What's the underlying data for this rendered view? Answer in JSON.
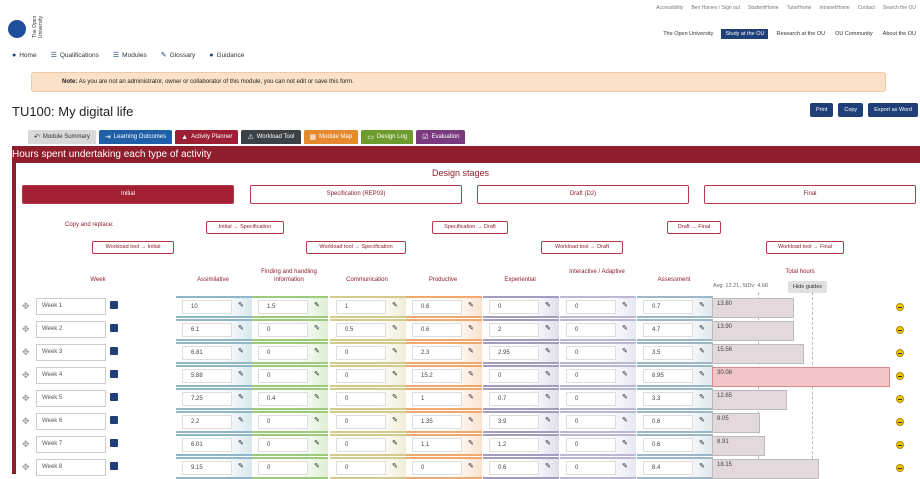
{
  "header": {
    "logo_text": "The Open University",
    "top_links": [
      "Accessibility",
      "Ben Harvey / Sign out",
      "StudentHome",
      "TutorHome",
      "IntranetHome",
      "Contact",
      "Search the OU"
    ],
    "site_nav": [
      "The Open University",
      "Study at the OU",
      "Research at the OU",
      "OU Community",
      "About the OU"
    ],
    "site_nav_active": "Study at the OU"
  },
  "main_nav": [
    {
      "label": "Home",
      "icon": "home-icon"
    },
    {
      "label": "Qualifications",
      "icon": "list-icon"
    },
    {
      "label": "Modules",
      "icon": "list-icon"
    },
    {
      "label": "Glossary",
      "icon": "glossary-icon"
    },
    {
      "label": "Guidance",
      "icon": "guidance-icon"
    }
  ],
  "note": {
    "strong": "Note:",
    "text": "As you are not an administrator, owner or collaborator of this module, you can not edit or save this form."
  },
  "page_title": "TU100: My digital life",
  "actions": [
    "Print",
    "Copy",
    "Export as Word"
  ],
  "tabs": [
    {
      "label": "Module Summary",
      "color": "#d8d8d8",
      "text": "#333"
    },
    {
      "label": "Learning Outcomes",
      "color": "#1f5fa8",
      "text": "#fff"
    },
    {
      "label": "Activity Planner",
      "color": "#9c1f33",
      "text": "#fff"
    },
    {
      "label": "Workload Tool",
      "color": "#3a4147",
      "text": "#fff"
    },
    {
      "label": "Module Map",
      "color": "#e58a2e",
      "text": "#fff"
    },
    {
      "label": "Design Log",
      "color": "#6e9b2d",
      "text": "#fff"
    },
    {
      "label": "Evaluation",
      "color": "#7a3a80",
      "text": "#fff"
    }
  ],
  "panel_title": "Hours spent undertaking each type of activity",
  "design_stages": {
    "heading": "Design stages",
    "stages": [
      "Initial",
      "Specification (REP03)",
      "Draft (D2)",
      "Final"
    ],
    "active": "Initial"
  },
  "copy_replace": {
    "label": "Copy and replace:",
    "transitions": [
      "Initial → Specification",
      "Specification → Draft",
      "Draft → Final"
    ],
    "workload": [
      "Workload tool → Initial",
      "Workload tool → Specification",
      "Workload tool → Draft",
      "Workload tool → Final"
    ]
  },
  "columns": {
    "week": "Week",
    "activities": [
      "Assimilative",
      "Finding and handling information",
      "Communication",
      "Productive",
      "Experiential",
      "Interactive / Adaptive",
      "Assessment"
    ],
    "total": "Total hours"
  },
  "avg_text": "Avg: 12.21, StDv: 4.68",
  "hide_guides": "Hide guides",
  "activity_colors": [
    "#8fb6c9",
    "#9ccc7a",
    "#d5c98c",
    "#f0a86c",
    "#a49bc0",
    "#b9b7d6",
    "#9cb8c8"
  ],
  "weeks": [
    {
      "label": "Week 1",
      "values": [
        "10",
        "1.5",
        "1",
        "0.6",
        "0",
        "0",
        "0.7"
      ],
      "total": "13.80"
    },
    {
      "label": "Week 2",
      "values": [
        "6.1",
        "0",
        "0.5",
        "0.6",
        "2",
        "0",
        "4.7"
      ],
      "total": "13.90"
    },
    {
      "label": "Week 3",
      "values": [
        "6.81",
        "0",
        "0",
        "2.3",
        "2.95",
        "0",
        "3.5"
      ],
      "total": "15.56"
    },
    {
      "label": "Week 4",
      "values": [
        "5.88",
        "0",
        "0",
        "15.2",
        "0",
        "0",
        "8.95"
      ],
      "total": "30.08"
    },
    {
      "label": "Week 5",
      "values": [
        "7.25",
        "0.4",
        "0",
        "1",
        "0.7",
        "0",
        "3.3"
      ],
      "total": "12.65"
    },
    {
      "label": "Week 6",
      "values": [
        "2.2",
        "0",
        "0",
        "1.35",
        "3.9",
        "0",
        "0.6"
      ],
      "total": "8.05"
    },
    {
      "label": "Week 7",
      "values": [
        "6.01",
        "0",
        "0",
        "1.1",
        "1.2",
        "0",
        "0.6"
      ],
      "total": "8.91"
    },
    {
      "label": "Week 8",
      "values": [
        "9.15",
        "0",
        "0",
        "0",
        "0.6",
        "0",
        "8.4"
      ],
      "total": "18.15"
    }
  ]
}
